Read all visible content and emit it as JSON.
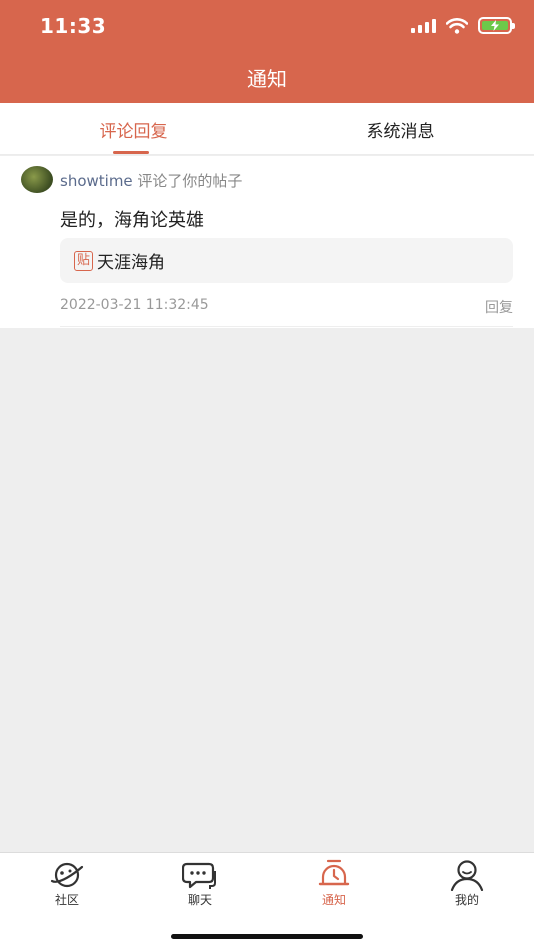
{
  "status_bar": {
    "time": "11:33"
  },
  "header": {
    "title": "通知"
  },
  "tabs": [
    {
      "label": "评论回复",
      "active": true
    },
    {
      "label": "系统消息",
      "active": false
    }
  ],
  "notification": {
    "username": "showtime",
    "action": " 评论了你的帖子",
    "comment": "是的，海角论英雄",
    "post_badge": "贴",
    "post_title": "天涯海角",
    "timestamp": "2022-03-21 11:32:45",
    "reply_label": "回复"
  },
  "tab_bar": [
    {
      "label": "社区",
      "icon": "planet-icon",
      "active": false
    },
    {
      "label": "聊天",
      "icon": "chat-bubbles-icon",
      "active": false
    },
    {
      "label": "通知",
      "icon": "bell-icon",
      "active": true
    },
    {
      "label": "我的",
      "icon": "person-icon",
      "active": false
    }
  ],
  "colors": {
    "accent": "#d7664d",
    "battery": "#6cc84a"
  }
}
